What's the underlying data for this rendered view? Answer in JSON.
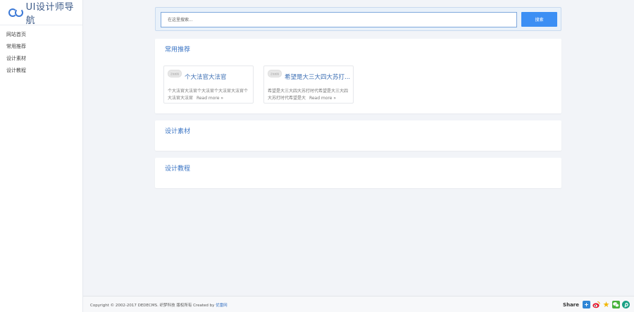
{
  "sidebar": {
    "logo_text": "UI设计师导航",
    "items": [
      {
        "label": "网站首页"
      },
      {
        "label": "常用推荐"
      },
      {
        "label": "设计素材"
      },
      {
        "label": "设计教程"
      }
    ]
  },
  "search": {
    "placeholder": "在这里搜索...",
    "button_label": "搜索"
  },
  "sections": [
    {
      "title": "常用推荐",
      "cards": [
        {
          "thumb_text": "正在加载",
          "title": "个大法官大法官",
          "description": "个大法官大法官个大法官个大法官大法官个大法官大法官",
          "more": "Read more »"
        },
        {
          "thumb_text": "正在加载",
          "title": "希望是大三大四大苏打...",
          "description": "希望是大三大四大苏打时代希望是大三大四大苏打时代希望是大",
          "more": "Read more »"
        }
      ]
    },
    {
      "title": "设计素材"
    },
    {
      "title": "设计教程"
    }
  ],
  "footer": {
    "copyright": "Copyright © 2002-2017 DEDECMS. 织梦科技 版权所有  Created by",
    "link_text": "优雷网",
    "share_label": "Share"
  },
  "icons": [
    "plus-icon",
    "weibo-icon",
    "star-icon",
    "wechat-icon",
    "pinterest-icon"
  ],
  "colors": {
    "accent": "#3c8ff4",
    "title_blue": "#3a74c4",
    "background": "#f2f4f8"
  }
}
